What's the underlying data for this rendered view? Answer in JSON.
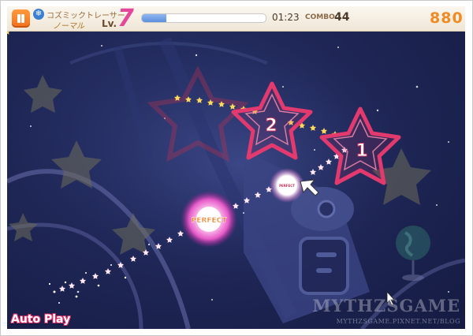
{
  "hud": {
    "song_title": "コズミックトレーサー",
    "difficulty": "ノーマル",
    "level_label": "Lv.",
    "level": "7",
    "time": "01:23",
    "combo_label": "COMBO:",
    "combo": "44",
    "score": "880",
    "progress": 0.2
  },
  "notes": [
    {
      "number": "1"
    },
    {
      "number": "2"
    }
  ],
  "judgements": {
    "perfect": "PERFECT",
    "small": "PERFECT"
  },
  "autoplay_label": "Auto Play",
  "watermark": {
    "title": "MYTHZSGAME",
    "url": "MYTHZSGAME.PIXNET.NET/BLOG"
  },
  "colors": {
    "accent": "#e4479a",
    "pause": "#f0701c",
    "note_ring": "#e0306a",
    "trail": "#ffd95a"
  }
}
